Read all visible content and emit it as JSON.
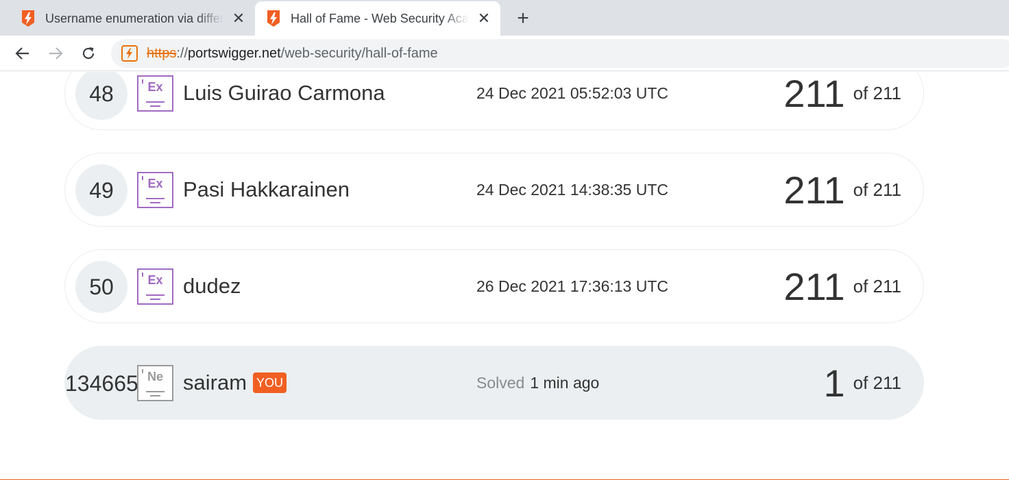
{
  "browser": {
    "tabs": [
      {
        "title": "Username enumeration via differe",
        "active": false
      },
      {
        "title": "Hall of Fame - Web Security Acad",
        "active": true
      }
    ],
    "new_tab_label": "+",
    "url": {
      "scheme": "https",
      "separator": "://",
      "host": "portswigger.net",
      "path": "/web-security/hall-of-fame"
    }
  },
  "leaderboard": {
    "rows": [
      {
        "rank": "48",
        "badge": "Ex",
        "name": "Luis Guirao Carmona",
        "date": "24 Dec 2021 05:52:03 UTC",
        "solved": "211",
        "total": "of 211"
      },
      {
        "rank": "49",
        "badge": "Ex",
        "name": "Pasi Hakkarainen",
        "date": "24 Dec 2021 14:38:35 UTC",
        "solved": "211",
        "total": "of 211"
      },
      {
        "rank": "50",
        "badge": "Ex",
        "name": "dudez",
        "date": "26 Dec 2021 17:36:13 UTC",
        "solved": "211",
        "total": "of 211"
      }
    ],
    "me": {
      "rank": "134665",
      "badge": "Ne",
      "name": "sairam",
      "you_label": "YOU",
      "solved_label": "Solved",
      "solved_time": "1 min ago",
      "solved": "1",
      "total": "of 211"
    }
  },
  "colors": {
    "accent": "#f15f22",
    "expert_badge": "#a16ac2",
    "newbie_badge": "#9a9a9a",
    "row_highlight": "#ebeff1"
  },
  "icons": {
    "favicon": "portswigger-lightning-icon",
    "back": "arrow-left-icon",
    "forward": "arrow-right-icon",
    "reload": "reload-icon",
    "close": "close-icon",
    "new_tab": "plus-icon",
    "site_info": "portswigger-lightning-icon"
  }
}
